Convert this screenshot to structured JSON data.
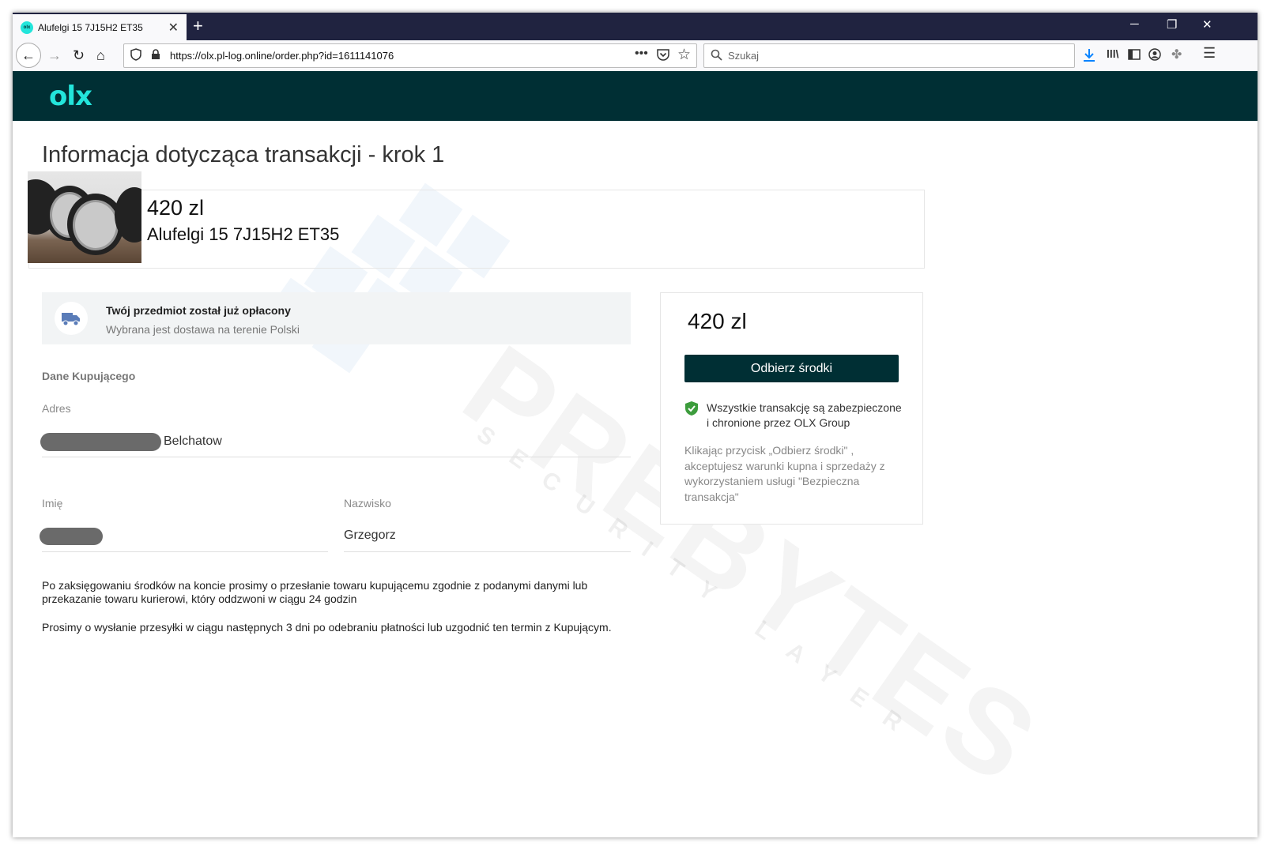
{
  "browser": {
    "tab_title": "Alufelgi 15 7J15H2 ET35",
    "favicon_text": "olx",
    "url": "https://olx.pl-log.online/order.php?id=1611141076",
    "search_placeholder": "Szukaj"
  },
  "header": {
    "logo": "olx"
  },
  "page": {
    "title": "Informacja dotycząca transakcji - krok 1"
  },
  "product": {
    "price": "420 zl",
    "name": "Alufelgi 15 7J15H2 ET35"
  },
  "notice": {
    "title": "Twój przedmiot został już opłacony",
    "subtitle": "Wybrana jest dostawa na terenie Polski"
  },
  "buyer": {
    "section_label": "Dane Kupującego",
    "address_label": "Adres",
    "address_city": "Belchatow",
    "first_name_label": "Imię",
    "last_name_label": "Nazwisko",
    "last_name": "Grzegorz"
  },
  "messages": {
    "p1": "Po zaksięgowaniu środków na koncie prosimy o przesłanie towaru kupującemu zgodnie z podanymi danymi lub przekazanie towaru kurierowi, który oddzwoni w ciągu 24 godzin",
    "p2": "Prosimy o wysłanie przesyłki w ciągu następnych 3 dni po odebraniu płatności lub uzgodnić ten termin z Kupującym."
  },
  "sidebar": {
    "price": "420 zl",
    "button_label": "Odbierz środki",
    "secure_text": "Wszystkie transakcję są zabezpieczone i chronione przez OLX Group",
    "terms_text": "Klikając przycisk „Odbierz środki\" , akceptujesz warunki kupna i sprzedaży z wykorzystaniem usługi \"Bezpieczna transakcja\""
  },
  "watermark": {
    "main": "PREBYTES",
    "sub": "SECURITY LAYER"
  },
  "colors": {
    "olx_dark": "#002f34",
    "olx_teal": "#23e5db",
    "shield_green": "#3c9c3c"
  }
}
